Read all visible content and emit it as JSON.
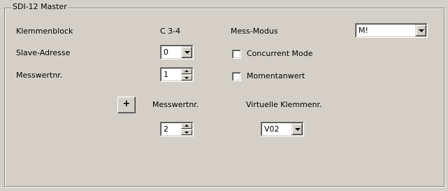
{
  "group": {
    "title": "SDI-12 Master"
  },
  "fields": {
    "klemmenblock_label": "Klemmenblock",
    "klemmenblock_value": "C 3-4",
    "slave_label": "Slave-Adresse",
    "slave_value": "0",
    "messwertnr_label": "Messwertnr.",
    "messwertnr_value": "1",
    "mess_modus_label": "Mess-Modus",
    "mess_modus_value": "M!",
    "concurrent_label": "Concurrent Mode",
    "concurrent_checked": false,
    "momentan_label": "Momentanwert",
    "momentan_checked": false
  },
  "virtual": {
    "plus_label": "+",
    "messwertnr_label": "Messwertnr.",
    "messwertnr_value": "2",
    "klemmenr_label": "Virtuelle Klemmenr.",
    "klemmenr_value": "V02"
  },
  "icons": [
    "chevron-down-icon",
    "spin-up-icon",
    "spin-down-icon"
  ]
}
